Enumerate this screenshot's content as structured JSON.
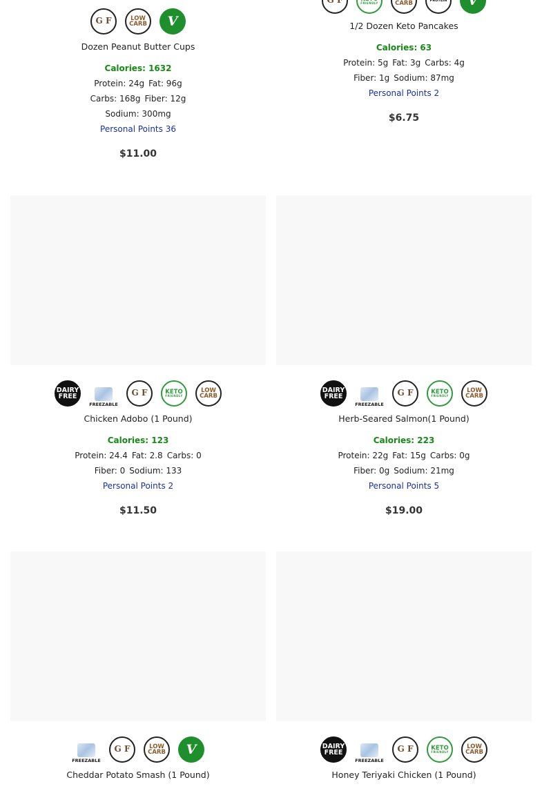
{
  "badge_labels": {
    "dairy_free": [
      "DAIRY",
      "FREE"
    ],
    "gf": "G F",
    "low_carb": [
      "LOW",
      "CARB"
    ],
    "keto": "KETO",
    "keto_sub": "FRIENDLY",
    "freezable": "FREEZABLE",
    "vegan": "V",
    "protein": "PROTEIN"
  },
  "products": [
    {
      "name": "Dozen Peanut Butter Cups",
      "badges": [
        "gluten-free",
        "low-carb",
        "vegan"
      ],
      "calories": "Calories: 1632",
      "nutrition_lines": [
        [
          "Protein: 24g",
          "Fat: 96g"
        ],
        [
          "Carbs: 168g",
          "Fiber: 12g"
        ],
        [
          "Sodium: 300mg"
        ]
      ],
      "points": "Personal Points 36",
      "price": "$11.00"
    },
    {
      "name": "1/2 Dozen Keto Pancakes",
      "badges": [
        "gluten-free",
        "keto-friendly",
        "low-carb",
        "high-protein",
        "vegan"
      ],
      "calories": "Calories: 63",
      "nutrition_lines": [
        [
          "Protein: 5g",
          "Fat: 3g",
          "Carbs: 4g"
        ],
        [
          "Fiber: 1g",
          "Sodium: 87mg"
        ]
      ],
      "points": "Personal Points 2",
      "price": "$6.75"
    },
    {
      "name": "Chicken Adobo (1 Pound)",
      "badges": [
        "dairy-free",
        "freezable",
        "gluten-free",
        "keto-friendly",
        "low-carb"
      ],
      "calories": "Calories: 123",
      "nutrition_lines": [
        [
          "Protein: 24.4",
          "Fat: 2.8",
          "Carbs: 0"
        ],
        [
          "Fiber: 0",
          "Sodium: 133"
        ]
      ],
      "points": "Personal Points 2",
      "price": "$11.50"
    },
    {
      "name": "Herb-Seared Salmon(1 Pound)",
      "badges": [
        "dairy-free",
        "freezable",
        "gluten-free",
        "keto-friendly",
        "low-carb"
      ],
      "calories": "Calories: 223",
      "nutrition_lines": [
        [
          "Protein: 22g",
          "Fat: 15g",
          "Carbs: 0g"
        ],
        [
          "Fiber: 0g",
          "Sodium: 21mg"
        ]
      ],
      "points": "Personal Points 5",
      "price": "$19.00"
    },
    {
      "name": "Cheddar Potato Smash (1 Pound)",
      "badges": [
        "freezable",
        "gluten-free",
        "low-carb",
        "vegan"
      ]
    },
    {
      "name": "Honey Teriyaki Chicken (1 Pound)",
      "badges": [
        "dairy-free",
        "freezable",
        "gluten-free",
        "keto-friendly",
        "low-carb"
      ]
    }
  ]
}
